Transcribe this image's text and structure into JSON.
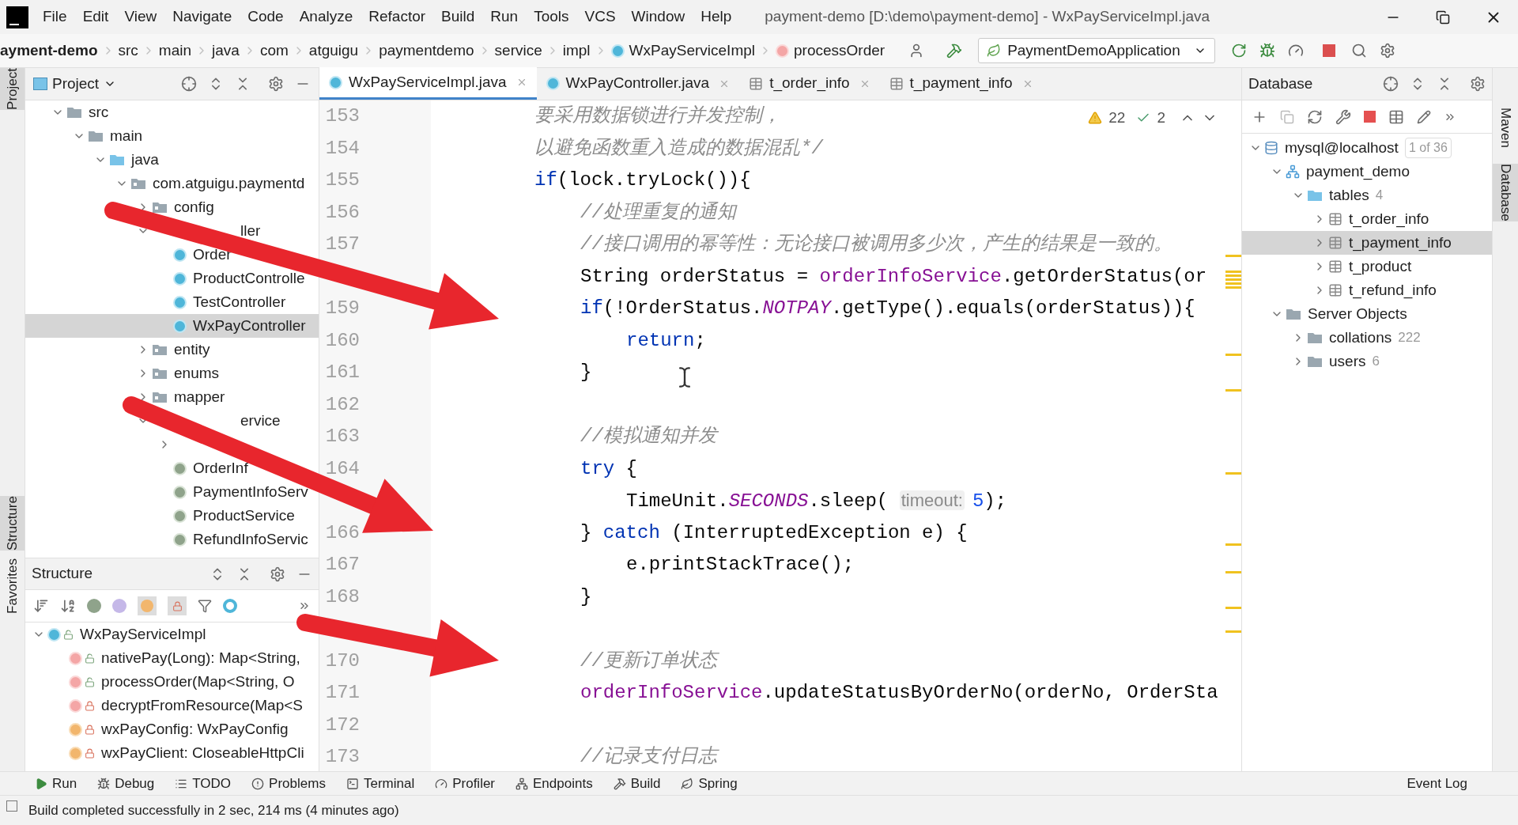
{
  "window": {
    "title": "payment-demo [D:\\demo\\payment-demo] - WxPayServiceImpl.java"
  },
  "menu": [
    "File",
    "Edit",
    "View",
    "Navigate",
    "Code",
    "Analyze",
    "Refactor",
    "Build",
    "Run",
    "Tools",
    "VCS",
    "Window",
    "Help"
  ],
  "breadcrumb": [
    {
      "label": "ayment-demo",
      "kind": "project"
    },
    {
      "label": "src",
      "kind": "folder"
    },
    {
      "label": "main",
      "kind": "folder"
    },
    {
      "label": "java",
      "kind": "folder"
    },
    {
      "label": "com",
      "kind": "folder"
    },
    {
      "label": "atguigu",
      "kind": "folder"
    },
    {
      "label": "paymentdemo",
      "kind": "folder"
    },
    {
      "label": "service",
      "kind": "folder"
    },
    {
      "label": "impl",
      "kind": "folder"
    },
    {
      "label": "WxPayServiceImpl",
      "kind": "class"
    },
    {
      "label": "processOrder",
      "kind": "method"
    }
  ],
  "run_config": "PaymentDemoApplication",
  "left_strip": [
    {
      "label": "Project",
      "selected": true
    },
    {
      "label": "Structure",
      "selected": true
    },
    {
      "label": "Favorites",
      "selected": false
    }
  ],
  "right_strip": [
    {
      "label": "Maven",
      "selected": false
    },
    {
      "label": "Database",
      "selected": true
    }
  ],
  "project_panel": {
    "title": "Project",
    "tree": [
      {
        "label": "src",
        "kind": "folder",
        "expanded": true,
        "selected": false,
        "children": [
          {
            "label": "main",
            "kind": "folder",
            "expanded": true,
            "selected": false,
            "children": [
              {
                "label": "java",
                "kind": "source",
                "expanded": true,
                "selected": false,
                "children": [
                  {
                    "label": "com.atguigu.paymentd",
                    "kind": "package",
                    "expanded": true,
                    "selected": false,
                    "children": [
                      {
                        "label": "config",
                        "kind": "package",
                        "expanded": false,
                        "selected": false
                      },
                      {
                        "label": "ller",
                        "kind": "hidden",
                        "expanded": true,
                        "selected": false,
                        "children": [
                          {
                            "label": "Order",
                            "kind": "class",
                            "selected": false
                          },
                          {
                            "label": "ProductControlle",
                            "kind": "class",
                            "selected": false
                          },
                          {
                            "label": "TestController",
                            "kind": "class",
                            "selected": false
                          },
                          {
                            "label": "WxPayController",
                            "kind": "class",
                            "selected": true
                          }
                        ]
                      },
                      {
                        "label": "entity",
                        "kind": "package",
                        "expanded": false,
                        "selected": false
                      },
                      {
                        "label": "enums",
                        "kind": "package",
                        "expanded": false,
                        "selected": false
                      },
                      {
                        "label": "mapper",
                        "kind": "package",
                        "expanded": false,
                        "selected": false
                      },
                      {
                        "label": "ervice",
                        "kind": "hidden",
                        "expanded": true,
                        "selected": false,
                        "children": [
                          {
                            "kind": "obscured",
                            "expanded": false,
                            "selected": false
                          },
                          {
                            "label": "OrderInf",
                            "kind": "interface",
                            "selected": false
                          },
                          {
                            "label": "PaymentInfoServ",
                            "kind": "interface",
                            "selected": false
                          },
                          {
                            "label": "ProductService",
                            "kind": "interface",
                            "selected": false
                          },
                          {
                            "label": "RefundInfoServic",
                            "kind": "interface",
                            "selected": false
                          }
                        ]
                      }
                    ]
                  }
                ]
              }
            ]
          }
        ]
      }
    ]
  },
  "editor_tabs": [
    {
      "label": "WxPayServiceImpl.java",
      "kind": "class",
      "selected": true
    },
    {
      "label": "WxPayController.java",
      "kind": "class",
      "selected": false
    },
    {
      "label": "t_order_info",
      "kind": "table",
      "selected": false
    },
    {
      "label": "t_payment_info",
      "kind": "table",
      "selected": false
    }
  ],
  "inspections": {
    "warnings": "22",
    "weak_warnings": "2"
  },
  "code_lines": [
    {
      "kind": "code",
      "number": "153",
      "tokens": [
        {
          "text": "要采用数据锁进行并发控制，",
          "kind": "comment"
        }
      ]
    },
    {
      "kind": "code",
      "number": "154",
      "tokens": [
        {
          "text": "以避免函数重入造成的数据混乱*/",
          "kind": "comment"
        }
      ]
    },
    {
      "kind": "code",
      "number": "155",
      "tokens": [
        {
          "text": "if",
          "kind": "keyword"
        },
        {
          "text": "(lock.tryLock()){",
          "kind": "plain"
        }
      ],
      "children": [
        {
          "kind": "code",
          "number": "156",
          "tokens": [
            {
              "text": "//处理重复的通知",
              "kind": "comment"
            }
          ]
        },
        {
          "kind": "code",
          "number": "157",
          "tokens": [
            {
              "text": "//接口调用的幂等性：无论接口被调用多少次，产生的结果是一致的。",
              "kind": "comment"
            }
          ]
        },
        {
          "kind": "code",
          "tokens": [
            {
              "text": "String orderStatus = ",
              "kind": "plain"
            },
            {
              "text": "orderInfoService",
              "kind": "field"
            },
            {
              "text": ".getOrderStatus(or",
              "kind": "plain"
            }
          ]
        },
        {
          "kind": "code",
          "number": "159",
          "tokens": [
            {
              "text": "if",
              "kind": "keyword"
            },
            {
              "text": "(!OrderStatus.",
              "kind": "plain"
            },
            {
              "text": "NOTPAY",
              "kind": "static"
            },
            {
              "text": ".getType().equals(orderStatus)){",
              "kind": "plain"
            }
          ],
          "children": [
            {
              "kind": "code",
              "number": "160",
              "tokens": [
                {
                  "text": "return",
                  "kind": "keyword"
                },
                {
                  "text": ";",
                  "kind": "plain"
                }
              ]
            }
          ]
        },
        {
          "kind": "code",
          "number": "161",
          "tokens": [
            {
              "text": "}",
              "kind": "plain"
            }
          ]
        },
        {
          "kind": "blank",
          "number": "162"
        },
        {
          "kind": "code",
          "number": "163",
          "tokens": [
            {
              "text": "//模拟通知并发",
              "kind": "comment"
            }
          ]
        },
        {
          "kind": "code",
          "number": "164",
          "tokens": [
            {
              "text": "try",
              "kind": "keyword"
            },
            {
              "text": " {",
              "kind": "plain"
            }
          ],
          "children": [
            {
              "kind": "code",
              "tokens": [
                {
                  "text": "TimeUnit.",
                  "kind": "plain"
                },
                {
                  "text": "SECONDS",
                  "kind": "static"
                },
                {
                  "text": ".sleep( ",
                  "kind": "plain"
                },
                {
                  "text": "timeout:",
                  "kind": "hint"
                },
                {
                  "text": "5",
                  "kind": "number"
                },
                {
                  "text": ");",
                  "kind": "plain"
                }
              ]
            }
          ]
        },
        {
          "kind": "code",
          "number": "166",
          "tokens": [
            {
              "text": "} ",
              "kind": "plain"
            },
            {
              "text": "catch",
              "kind": "keyword"
            },
            {
              "text": " (InterruptedException e) {",
              "kind": "plain"
            }
          ],
          "children": [
            {
              "kind": "code",
              "number": "167",
              "tokens": [
                {
                  "text": "e.printStackTrace();",
                  "kind": "plain"
                }
              ]
            }
          ]
        },
        {
          "kind": "code",
          "number": "168",
          "tokens": [
            {
              "text": "}",
              "kind": "plain"
            }
          ]
        },
        {
          "kind": "blank"
        },
        {
          "kind": "code",
          "number": "170",
          "tokens": [
            {
              "text": "//更新订单状态",
              "kind": "comment"
            }
          ]
        },
        {
          "kind": "code",
          "number": "171",
          "tokens": [
            {
              "text": "orderInfoService",
              "kind": "field"
            },
            {
              "text": ".updateStatusByOrderNo(orderNo, OrderSta",
              "kind": "plain"
            }
          ]
        },
        {
          "kind": "blank",
          "number": "172"
        },
        {
          "kind": "code",
          "number": "173",
          "tokens": [
            {
              "text": "//记录支付日志",
              "kind": "comment"
            }
          ]
        }
      ]
    }
  ],
  "structure_panel": {
    "title": "Structure",
    "tree": [
      {
        "label": "WxPayServiceImpl",
        "kind": "class",
        "private": false,
        "expanded": true,
        "children": [
          {
            "label": "nativePay(Long): Map<String,",
            "kind": "method",
            "private": false
          },
          {
            "label": "processOrder(Map<String, O",
            "kind": "method",
            "private": false
          },
          {
            "label": "decryptFromResource(Map<S",
            "kind": "method",
            "private": true
          },
          {
            "label": "wxPayConfig: WxPayConfig",
            "kind": "field",
            "private": true
          },
          {
            "label": "wxPayClient: CloseableHttpCli",
            "kind": "field",
            "private": true
          }
        ]
      }
    ]
  },
  "database_panel": {
    "title": "Database",
    "tree": [
      {
        "label": "mysql@localhost",
        "badge": "1 of 36",
        "kind": "datasource",
        "expanded": true,
        "selected": false,
        "children": [
          {
            "label": "payment_demo",
            "kind": "schema",
            "expanded": true,
            "selected": false,
            "children": [
              {
                "label": "tables",
                "count": "4",
                "kind": "source",
                "expanded": true,
                "selected": false,
                "children": [
                  {
                    "label": "t_order_info",
                    "kind": "table",
                    "expanded": false,
                    "selected": false
                  },
                  {
                    "label": "t_payment_info",
                    "kind": "table",
                    "expanded": false,
                    "selected": true
                  },
                  {
                    "label": "t_product",
                    "kind": "table",
                    "expanded": false,
                    "selected": false
                  },
                  {
                    "label": "t_refund_info",
                    "kind": "table",
                    "expanded": false,
                    "selected": false
                  }
                ]
              }
            ]
          },
          {
            "label": "Server Objects",
            "kind": "folder",
            "expanded": true,
            "selected": false,
            "children": [
              {
                "label": "collations",
                "count": "222",
                "kind": "folder",
                "expanded": false,
                "selected": false
              },
              {
                "label": "users",
                "count": "6",
                "kind": "folder",
                "expanded": false,
                "selected": false
              }
            ]
          }
        ]
      }
    ]
  },
  "tool_strip": [
    {
      "label": "Run",
      "kind": "run"
    },
    {
      "label": "Debug",
      "kind": "debug"
    },
    {
      "label": "TODO",
      "kind": "todo"
    },
    {
      "label": "Problems",
      "kind": "problems"
    },
    {
      "label": "Terminal",
      "kind": "terminal"
    },
    {
      "label": "Profiler",
      "kind": "profiler"
    },
    {
      "label": "Endpoints",
      "kind": "endpoints"
    },
    {
      "label": "Build",
      "kind": "build"
    },
    {
      "label": "Spring",
      "kind": "spring"
    },
    {
      "label": "Event Log",
      "kind": "log"
    }
  ],
  "status_bar": {
    "message": "Build completed successfully in 2 sec, 214 ms (4 minutes ago)"
  }
}
